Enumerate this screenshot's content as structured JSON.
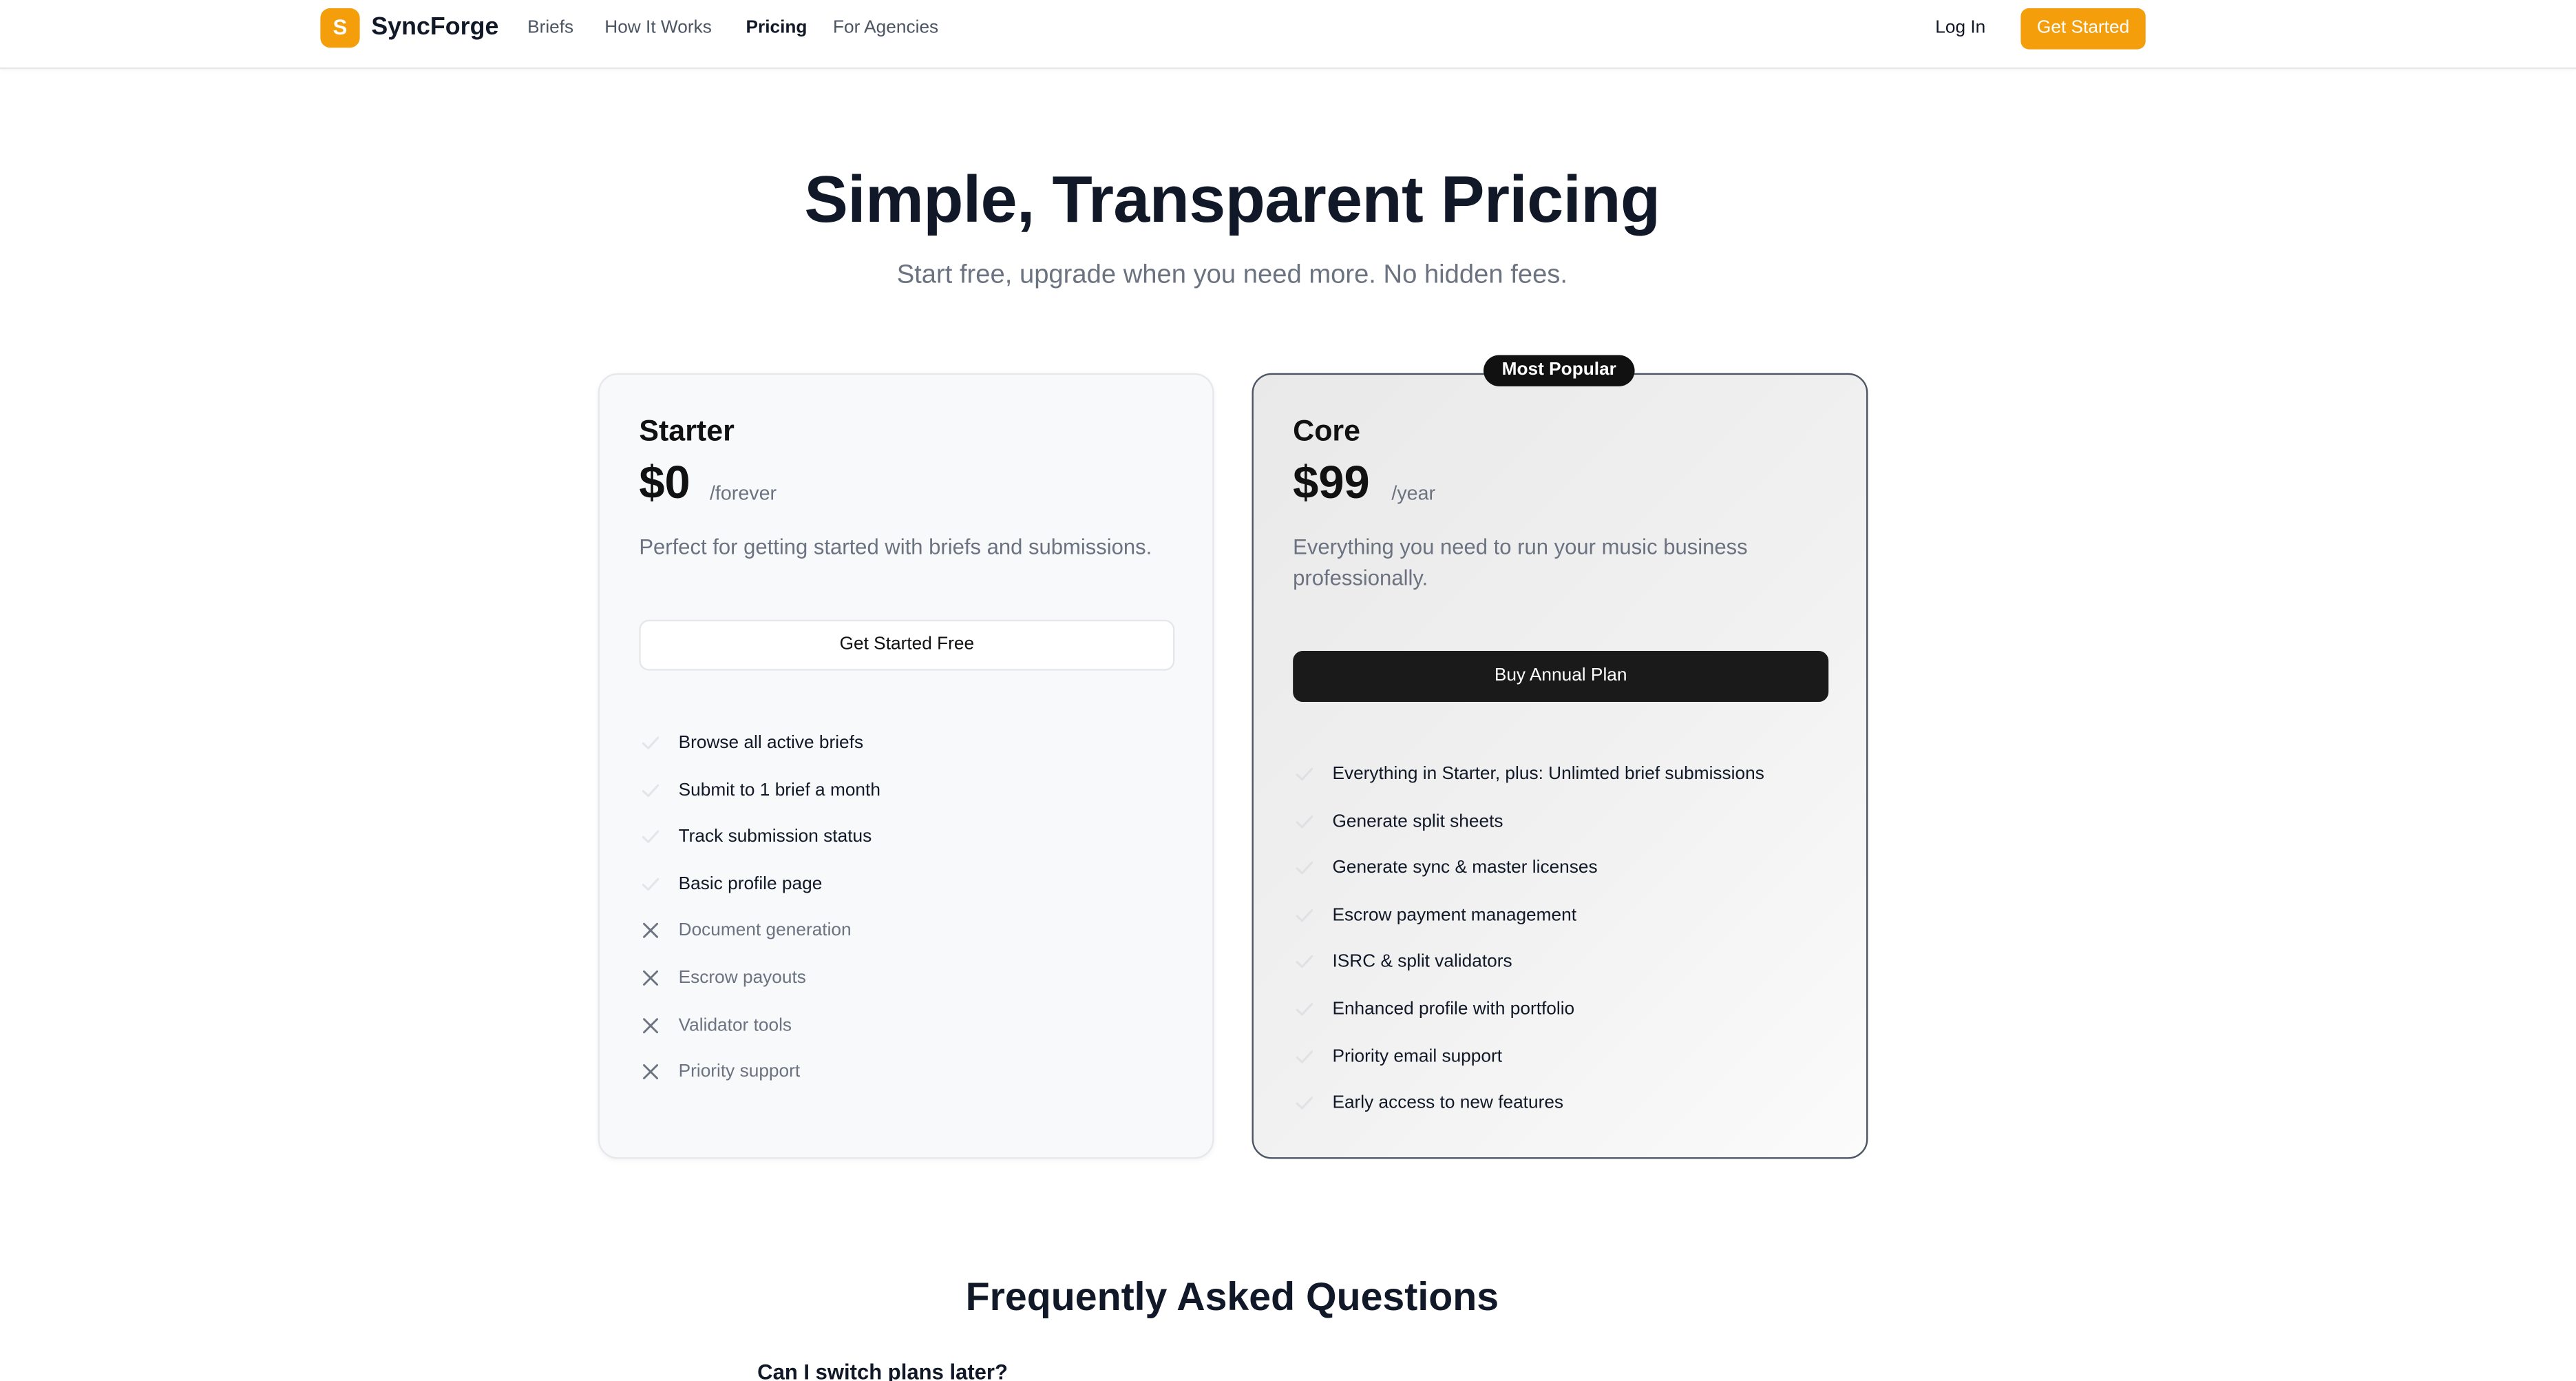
{
  "header": {
    "brand_initial": "S",
    "brand": "SyncForge",
    "nav": [
      "Briefs",
      "How It Works",
      "Pricing",
      "For Agencies"
    ],
    "active_nav": "Pricing",
    "login": "Log In",
    "cta": "Get Started"
  },
  "hero": {
    "title": "Simple, Transparent Pricing",
    "subtitle": "Start free, upgrade when you need more. No hidden fees."
  },
  "plans": [
    {
      "name": "Starter",
      "price": "$0",
      "period": "/forever",
      "description": "Perfect for getting started with briefs and submissions.",
      "button": "Get Started Free",
      "features": [
        {
          "text": "Browse all active briefs",
          "included": true
        },
        {
          "text": "Submit to 1 brief a month",
          "included": true
        },
        {
          "text": "Track submission status",
          "included": true
        },
        {
          "text": "Basic profile page",
          "included": true
        },
        {
          "text": "Document generation",
          "included": false
        },
        {
          "text": "Escrow payouts",
          "included": false
        },
        {
          "text": "Validator tools",
          "included": false
        },
        {
          "text": "Priority support",
          "included": false
        }
      ]
    },
    {
      "name": "Core",
      "badge": "Most Popular",
      "price": "$99",
      "period": "/year",
      "description": "Everything you need to run your music business professionally.",
      "button": "Buy Annual Plan",
      "features": [
        {
          "text": "Everything in Starter, plus: Unlimted brief submissions",
          "included": true
        },
        {
          "text": "Generate split sheets",
          "included": true
        },
        {
          "text": "Generate sync & master licenses",
          "included": true
        },
        {
          "text": "Escrow payment management",
          "included": true
        },
        {
          "text": "ISRC & split validators",
          "included": true
        },
        {
          "text": "Enhanced profile with portfolio",
          "included": true
        },
        {
          "text": "Priority email support",
          "included": true
        },
        {
          "text": "Early access to new features",
          "included": true
        }
      ]
    }
  ],
  "faq": {
    "title": "Frequently Asked Questions",
    "first_question": "Can I switch plans later?"
  },
  "colors": {
    "accent": "#f59e0b",
    "dark_button": "#1a1a1a",
    "muted_text": "#6b7280",
    "check_icon": "#d1d5db",
    "x_icon": "#6b7280"
  }
}
